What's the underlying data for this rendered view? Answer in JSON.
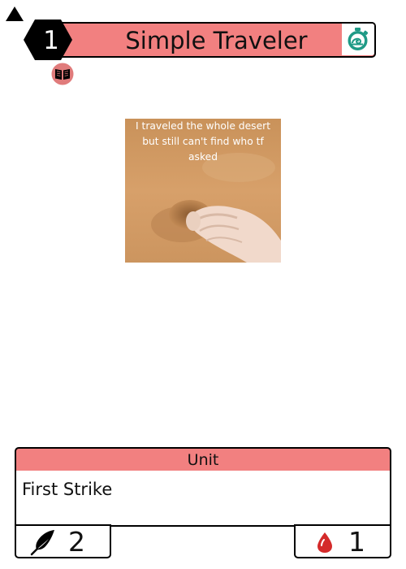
{
  "card": {
    "name": "Simple Traveler",
    "energy_cost": "1",
    "type_line": "Unit",
    "ability_text": "First Strike",
    "attack": "2",
    "health": "1",
    "art_caption": "I traveled the whole desert\nbut still can't find who tf\nasked"
  },
  "icons": {
    "corner": "triangle-up-icon",
    "energy": "lightning-bolt-icon",
    "timer": "snail-stopwatch-icon",
    "book": "open-book-icon",
    "attack": "feather-quill-icon",
    "health": "blood-drop-icon"
  },
  "colors": {
    "banner": "#f28080",
    "hex_fill": "#000000",
    "timer_icon": "#1f9a86",
    "book_badge": "#e07b7b",
    "blood": "#d42a2a"
  }
}
